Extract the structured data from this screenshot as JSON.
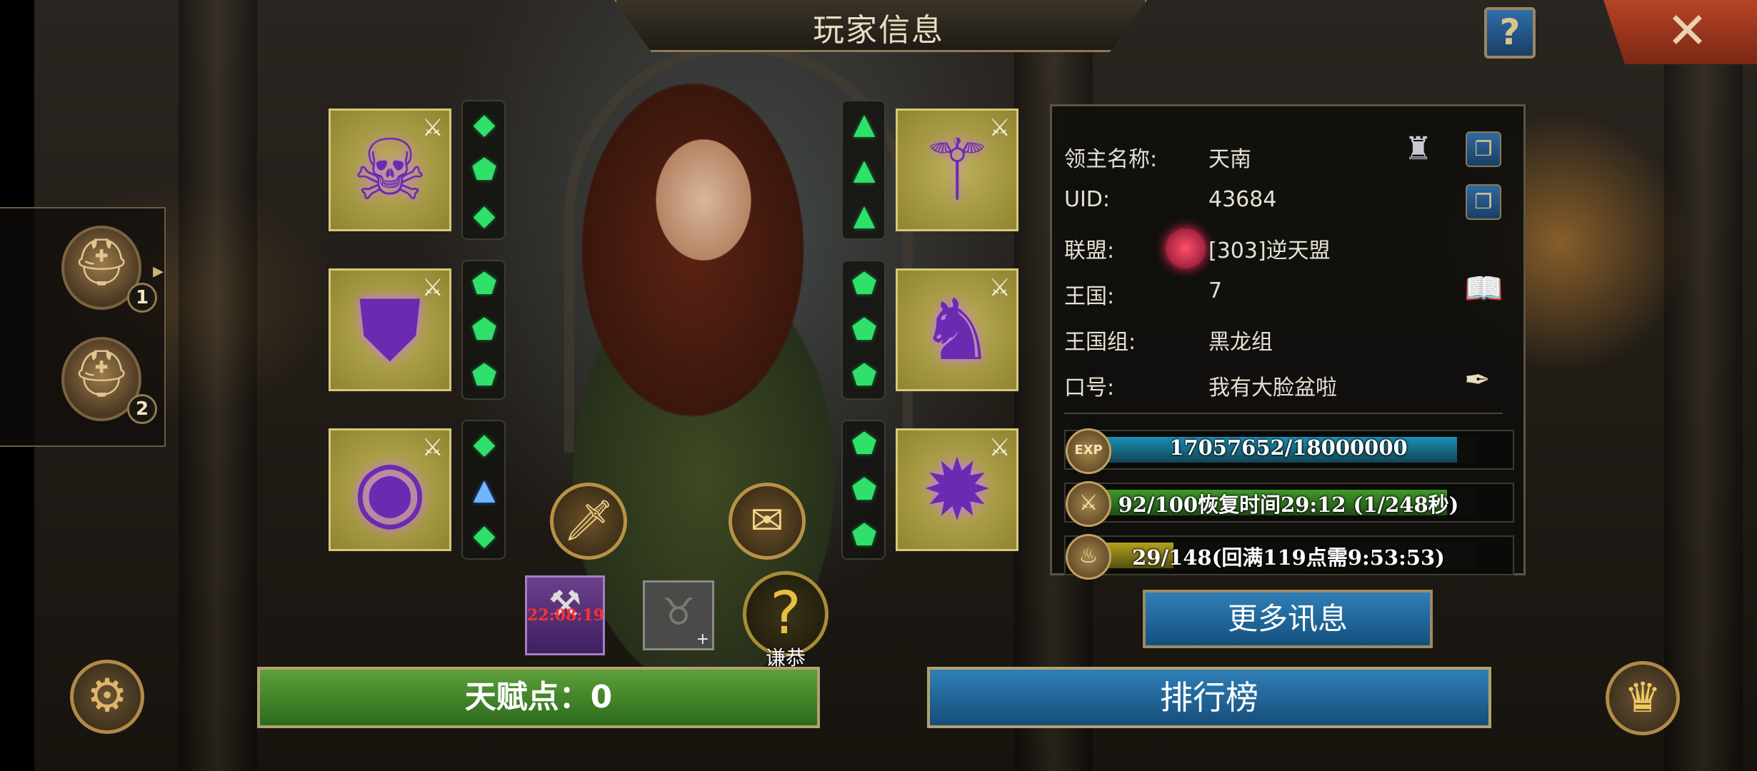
{
  "header": {
    "title": "玩家信息",
    "help_glyph": "?",
    "close_glyph": "✕"
  },
  "slots": [
    {
      "number": "1",
      "icon": "helmet-icon"
    },
    {
      "number": "2",
      "icon": "helmet-icon"
    }
  ],
  "equipment": {
    "left": [
      {
        "name": "helmet",
        "icon": "purple-skull-helm-icon"
      },
      {
        "name": "armor",
        "icon": "purple-armor-icon"
      },
      {
        "name": "ring",
        "icon": "purple-eye-ring-icon"
      }
    ],
    "right": [
      {
        "name": "weapon",
        "icon": "purple-staff-icon"
      },
      {
        "name": "boots",
        "icon": "purple-boots-icon"
      },
      {
        "name": "accessory",
        "icon": "purple-orb-icon"
      }
    ]
  },
  "buff_timer": "22:08:19",
  "title_badge": {
    "label": "谦恭"
  },
  "info": {
    "lord_name_label": "领主名称:",
    "lord_name": "天南",
    "uid_label": "UID:",
    "uid": "43684",
    "alliance_label": "联盟:",
    "alliance": "[303]逆天盟",
    "kingdom_label": "王国:",
    "kingdom": "7",
    "kingdom_group_label": "王国组:",
    "kingdom_group": "黑龙组",
    "slogan_label": "口号:",
    "slogan": "我有大脸盆啦"
  },
  "stats": {
    "exp": {
      "text": "17057652/18000000",
      "icon_label": "EXP",
      "fraction": 0.9476,
      "color": "#1c8fb5"
    },
    "stamina": {
      "text": "92/100恢复时间29:12 (1/248秒)",
      "fraction": 0.92,
      "color": "#3f9a2a"
    },
    "energy": {
      "text": "29/148(回满119点需9:53:53)",
      "fraction": 0.196,
      "color": "#b3a21c"
    }
  },
  "buttons": {
    "more_info": "更多讯息",
    "talent": "天赋点：0",
    "ranking": "排行榜"
  }
}
